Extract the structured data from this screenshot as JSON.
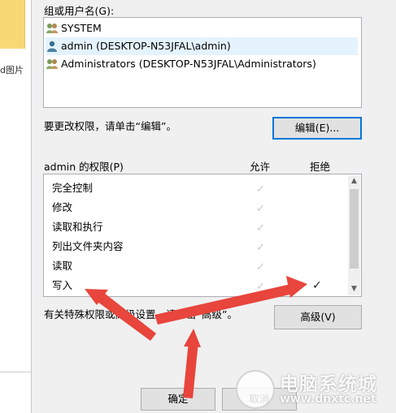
{
  "background": {
    "fragment_label": "d图片"
  },
  "dialog": {
    "group_label": "组或用户名(G):",
    "users": [
      {
        "name": "SYSTEM",
        "icon": "users-group-icon",
        "selected": false
      },
      {
        "name": "admin (DESKTOP-N53JFAL\\admin)",
        "icon": "user-icon",
        "selected": true
      },
      {
        "name": "Administrators (DESKTOP-N53JFAL\\Administrators)",
        "icon": "users-group-icon",
        "selected": false
      }
    ],
    "edit_hint": "要更改权限，请单击“编辑”。",
    "edit_button": "编辑(E)...",
    "perm_header": "admin 的权限(P)",
    "allow_header": "允许",
    "deny_header": "拒绝",
    "permissions": [
      {
        "name": "完全控制",
        "allow": "✓",
        "deny": ""
      },
      {
        "name": "修改",
        "allow": "✓",
        "deny": ""
      },
      {
        "name": "读取和执行",
        "allow": "✓",
        "deny": ""
      },
      {
        "name": "列出文件夹内容",
        "allow": "✓",
        "deny": ""
      },
      {
        "name": "读取",
        "allow": "✓",
        "deny": ""
      },
      {
        "name": "写入",
        "allow": "✓",
        "deny": "✓"
      }
    ],
    "advanced_hint": "有关特殊权限或高级设置，请单击“高级”。",
    "advanced_button": "高级(V)",
    "ok_button": "确定",
    "cancel_button": "取消"
  },
  "watermark": {
    "brand": "电脑系统城",
    "url": "www.dnxtc.net"
  },
  "colors": {
    "annotation_arrow": "#e8453c",
    "focus_border": "#0078d7",
    "selection": "#e5f3ff"
  }
}
